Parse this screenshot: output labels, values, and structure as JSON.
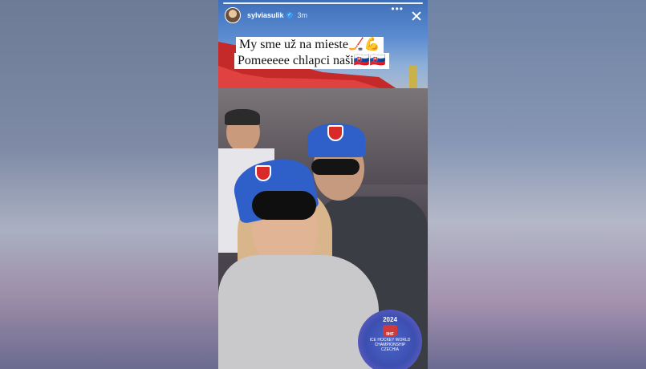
{
  "story": {
    "username": "sylviasulik",
    "timestamp": "3m",
    "more_label": "•••",
    "caption_line1": "My sme už na mieste🏒💪",
    "caption_line2": "Pomeeeee chlapci naši🇸🇰🇸🇰",
    "badge": {
      "year": "2024",
      "org": "IIHF",
      "event": "ICE HOCKEY WORLD CHAMPIONSHIP",
      "city": "CZECHIA"
    }
  },
  "colors": {
    "accent_blue": "#2f5fc9",
    "tent_red": "#d42a2a",
    "verified": "#3897f0"
  }
}
